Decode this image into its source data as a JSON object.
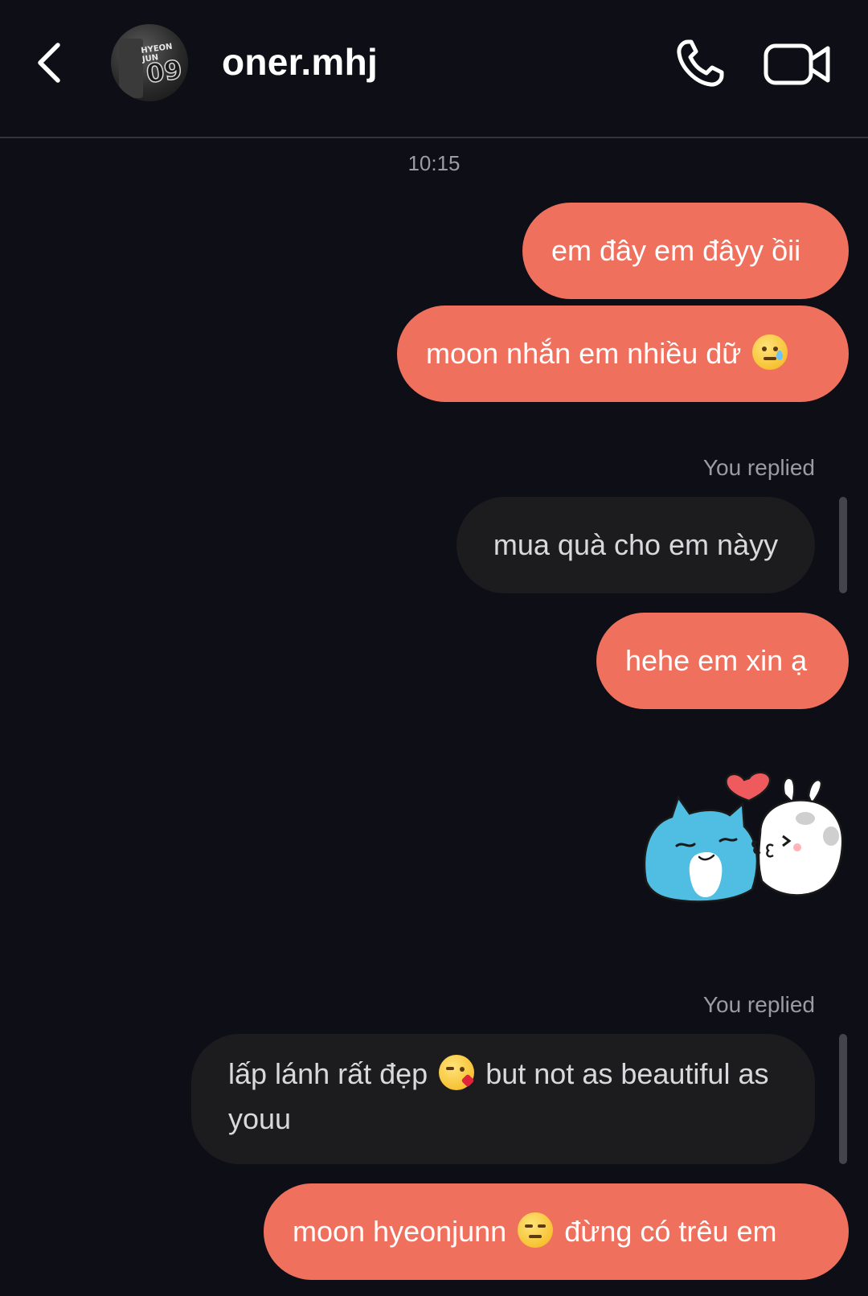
{
  "header": {
    "username": "oner.mhj",
    "avatar_jersey_text": "HYEON JUN",
    "avatar_jersey_number": "09",
    "icons": {
      "back": "chevron-left-icon",
      "call": "phone-icon",
      "video": "video-camera-icon"
    }
  },
  "conversation": {
    "timestamp": "10:15",
    "colors": {
      "background": "#0e0f16",
      "sent_bubble": "#f0705e",
      "sent_bubble_last": "#f39b6b",
      "reply_bubble": "#1c1c1f"
    },
    "messages": [
      {
        "type": "sent",
        "text": "em đây em đâyy ồii"
      },
      {
        "type": "sent",
        "text_before_emoji": "moon nhắn em nhiều dữ",
        "emoji": "smiling-face-with-tear"
      },
      {
        "type": "reply-quote",
        "label": "You replied",
        "quoted_text": "mua quà cho em nàyy"
      },
      {
        "type": "sent",
        "text": "hehe em xin ạ"
      },
      {
        "type": "sticker",
        "description": "cat-and-bunny-kiss-sticker"
      },
      {
        "type": "reply-quote",
        "label": "You replied",
        "text_before_emoji": "lấp lánh rất đẹp",
        "emoji": "face-blowing-a-kiss",
        "text_after_emoji": "but not as beautiful as youu"
      },
      {
        "type": "sent",
        "text_before_emoji": "moon hyeonjunn",
        "emoji": "expressionless-face",
        "text_after_emoji": "đừng có trêu em"
      }
    ]
  }
}
